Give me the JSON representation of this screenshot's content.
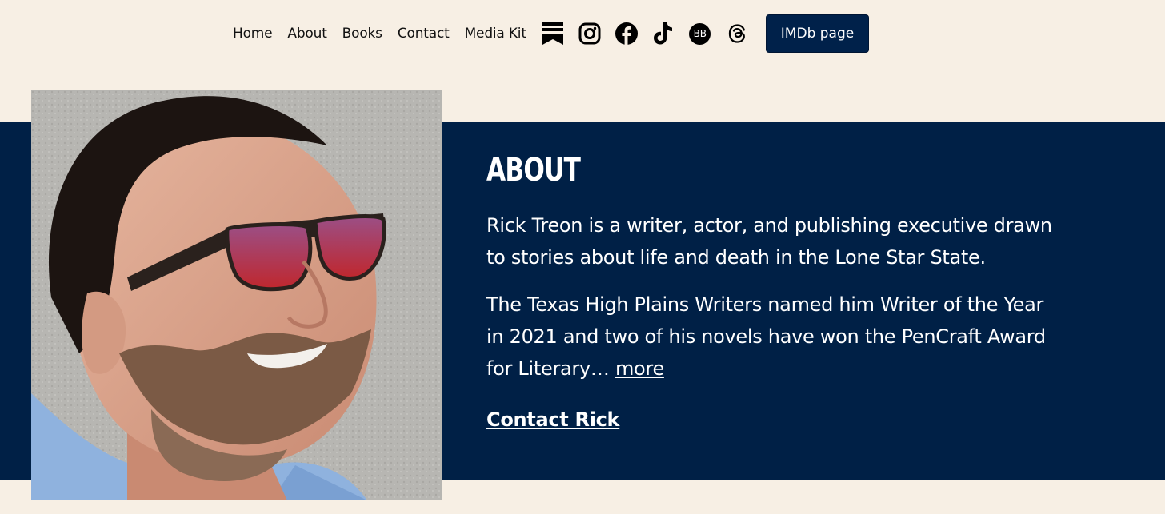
{
  "nav": {
    "links": [
      "Home",
      "About",
      "Books",
      "Contact",
      "Media Kit"
    ],
    "icons": [
      "substack-icon",
      "instagram-icon",
      "facebook-icon",
      "tiktok-icon",
      "bookbub-icon",
      "threads-icon"
    ],
    "bookbub_label": "BB",
    "imdb_button": "IMDb page"
  },
  "about": {
    "title": "ABOUT",
    "paragraph1": "Rick Treon is a writer, actor, and publishing executive drawn to stories about life and death in the Lone Star State.",
    "paragraph2": "The Texas High Plains Writers named him Writer of the Year in 2021 and two of his novels have won the PenCraft Award for Literary…",
    "more_link": "more",
    "contact_link": "Contact Rick"
  },
  "colors": {
    "background": "#f7efe4",
    "band": "#002046",
    "button": "#00214a"
  }
}
